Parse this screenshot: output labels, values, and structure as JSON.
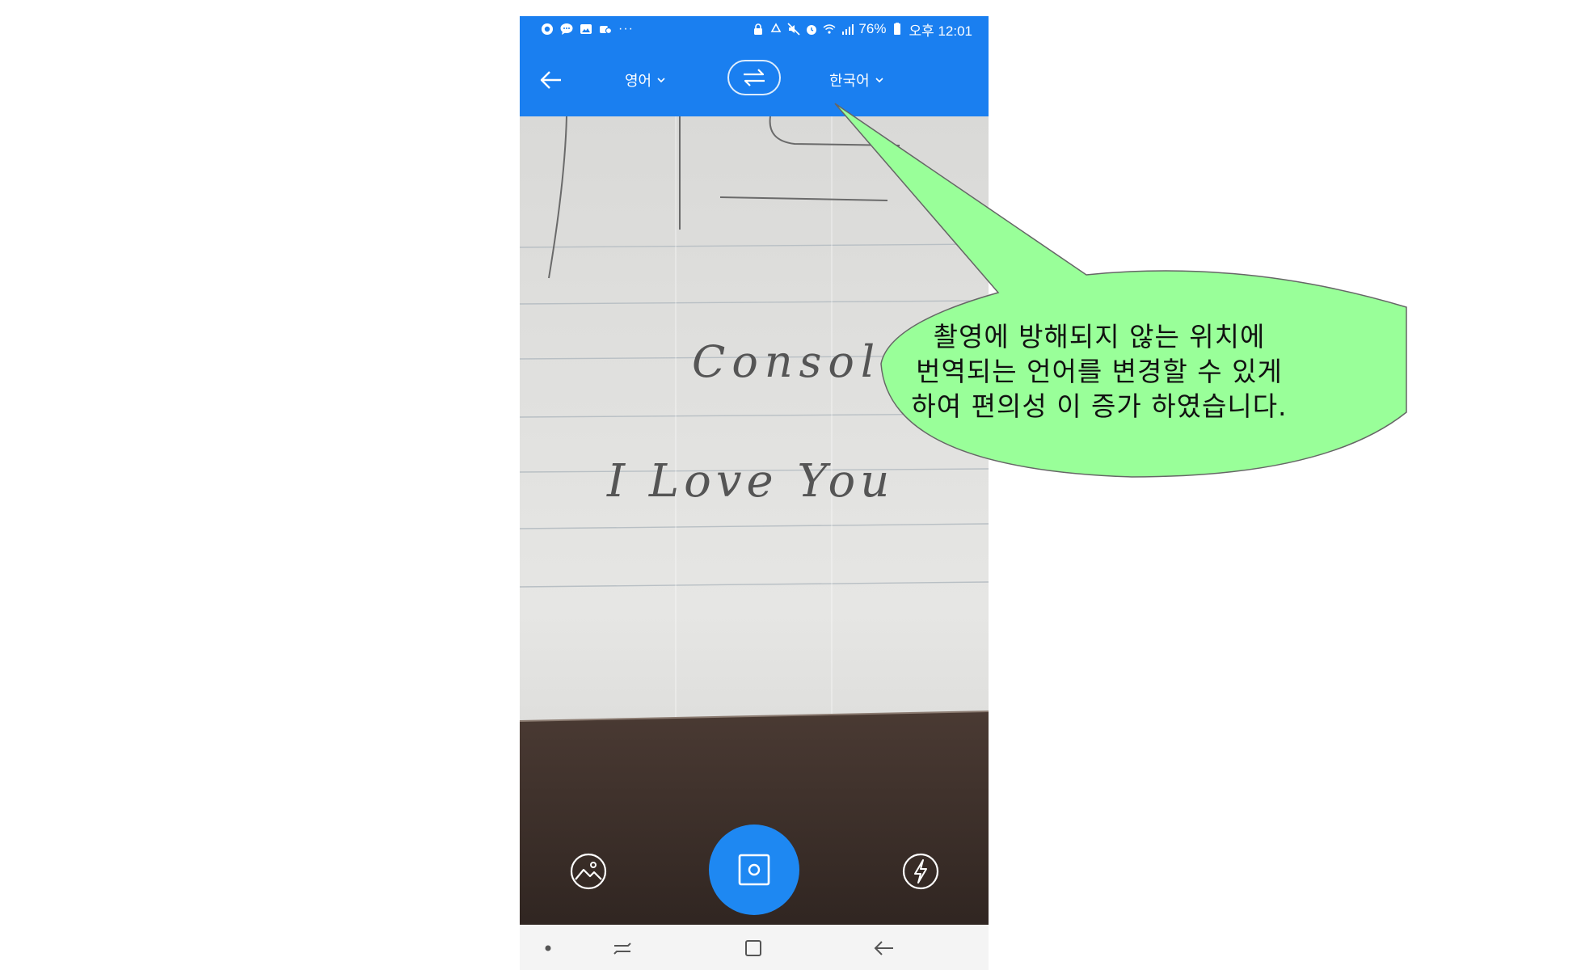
{
  "status_bar": {
    "battery": "76%",
    "time": "오후 12:01",
    "left_icons": [
      "app-icon",
      "chat-icon",
      "gallery-icon",
      "link-icon"
    ],
    "more": "···"
  },
  "app_bar": {
    "source_language": "영어",
    "target_language": "한국어",
    "accent_color": "#1a7ff0"
  },
  "camera_preview": {
    "handwriting": [
      "Console",
      "I Love You"
    ]
  },
  "camera_controls": {
    "shutter_color": "#1e88f2"
  },
  "callout": {
    "lines": [
      "촬영에 방해되지 않는 위치에",
      "번역되는 언어를 변경할 수 있게",
      "하여 편의성 이 증가 하였습니다."
    ],
    "fill_color": "#99ff99"
  }
}
